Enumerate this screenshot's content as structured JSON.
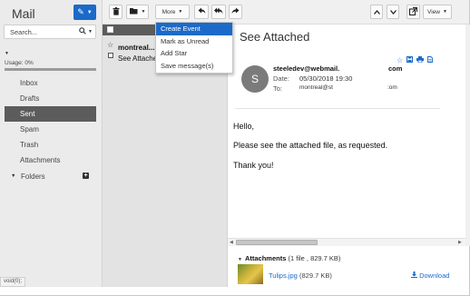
{
  "app": {
    "title": "Mail"
  },
  "sidebar": {
    "search_placeholder": "Search...",
    "usage_label": "Usage: 0%",
    "usage_fraction": 0.0,
    "items": [
      {
        "label": "Inbox",
        "active": false
      },
      {
        "label": "Drafts",
        "active": false
      },
      {
        "label": "Sent",
        "active": true
      },
      {
        "label": "Spam",
        "active": false
      },
      {
        "label": "Trash",
        "active": false
      },
      {
        "label": "Attachments",
        "active": false
      }
    ],
    "folders_label": "Folders"
  },
  "toolbar": {
    "more_label": "More",
    "view_label": "View"
  },
  "dropdown": {
    "items": [
      "Create Event",
      "Mark as Unread",
      "Add Star",
      "Save message(s)"
    ]
  },
  "list": {
    "messages": [
      {
        "from": "montreal...",
        "subject": "See Attached"
      }
    ]
  },
  "message": {
    "subject": "See Attached",
    "avatar_letter": "S",
    "sender": "steeledev@webmail.",
    "sender_extra": "com",
    "date_label": "Date:",
    "date": "05/30/2018 19:30",
    "to_label": "To:",
    "to": "montreal@st",
    "to_extra": ":om",
    "body": [
      "Hello,",
      "Please see the attached file, as requested.",
      "Thank you!"
    ],
    "attachments_label": "Attachments",
    "attachments_meta": "(1 file , 829.7 KB)",
    "attachment_name": "Tulips.jpg",
    "attachment_size": "(829.7 KB)",
    "download_label": "Download"
  },
  "status": {
    "url": "void(0);"
  },
  "colors": {
    "accent": "#1b6ac9",
    "active_folder": "#5c5c5c",
    "sidebar_bg": "#ebebeb"
  }
}
